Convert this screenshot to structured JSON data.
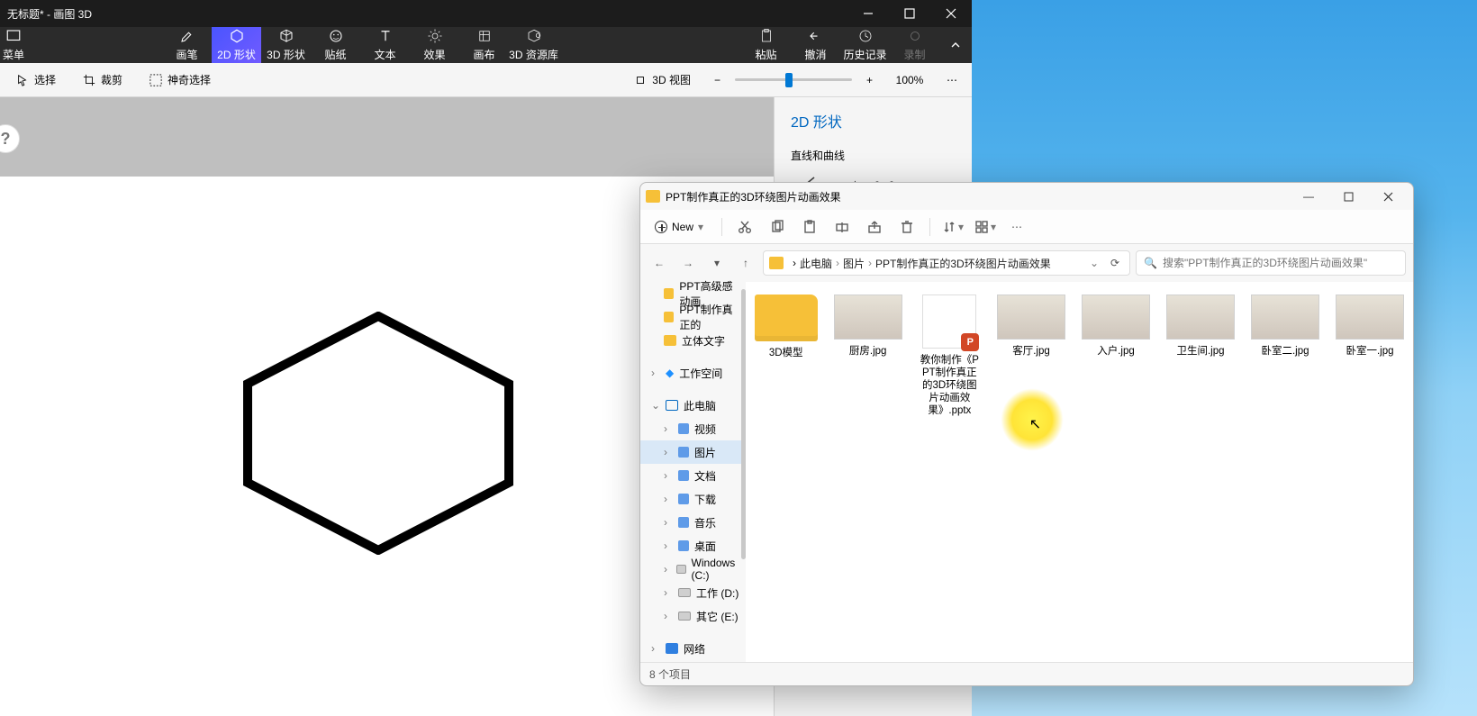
{
  "paint": {
    "title": "无标题* - 画图 3D",
    "menu_label": "菜单",
    "ribbon": [
      {
        "id": "brush",
        "label": "画笔"
      },
      {
        "id": "2d",
        "label": "2D 形状"
      },
      {
        "id": "3d",
        "label": "3D 形状"
      },
      {
        "id": "sticker",
        "label": "贴纸"
      },
      {
        "id": "text",
        "label": "文本"
      },
      {
        "id": "effects",
        "label": "效果"
      },
      {
        "id": "canvas",
        "label": "画布"
      },
      {
        "id": "library",
        "label": "3D 资源库"
      }
    ],
    "ribbon_selected": "2d",
    "right_group": [
      {
        "id": "paste",
        "label": "粘贴"
      },
      {
        "id": "undo",
        "label": "撤消"
      },
      {
        "id": "history",
        "label": "历史记录"
      },
      {
        "id": "record",
        "label": "录制"
      }
    ],
    "subbar": {
      "select": "选择",
      "crop": "裁剪",
      "magic": "神奇选择",
      "view3d": "3D 视图",
      "zoom_pct": "100%"
    },
    "side": {
      "header": "2D 形状",
      "lines": "直线和曲线",
      "shapes": "2D 形状"
    },
    "hint": "?"
  },
  "explorer": {
    "title": "PPT制作真正的3D环绕图片动画效果",
    "new_label": "New",
    "breadcrumb": [
      "此电脑",
      "图片",
      "PPT制作真正的3D环绕图片动画效果"
    ],
    "search_placeholder": "搜索\"PPT制作真正的3D环绕图片动画效果\"",
    "quick": [
      "PPT高级感动画",
      "PPT制作真正的",
      "立体文字"
    ],
    "tree": {
      "workspace": "工作空间",
      "this_pc": "此电脑",
      "children": [
        {
          "id": "video",
          "label": "视频"
        },
        {
          "id": "pictures",
          "label": "图片"
        },
        {
          "id": "documents",
          "label": "文档"
        },
        {
          "id": "downloads",
          "label": "下载"
        },
        {
          "id": "music",
          "label": "音乐"
        },
        {
          "id": "desktop",
          "label": "桌面"
        },
        {
          "id": "c",
          "label": "Windows (C:)"
        },
        {
          "id": "d",
          "label": "工作 (D:)"
        },
        {
          "id": "e",
          "label": "其它 (E:)"
        }
      ],
      "selected": "pictures",
      "network": "网络"
    },
    "items": [
      {
        "name": "3D模型",
        "kind": "folder"
      },
      {
        "name": "厨房.jpg",
        "kind": "jpg"
      },
      {
        "name": "教你制作《PPT制作真正的3D环绕图片动画效果》.pptx",
        "kind": "pptx"
      },
      {
        "name": "客厅.jpg",
        "kind": "jpg"
      },
      {
        "name": "入户.jpg",
        "kind": "jpg"
      },
      {
        "name": "卫生间.jpg",
        "kind": "jpg"
      },
      {
        "name": "卧室二.jpg",
        "kind": "jpg"
      },
      {
        "name": "卧室一.jpg",
        "kind": "jpg"
      }
    ],
    "status": "8 个项目"
  }
}
